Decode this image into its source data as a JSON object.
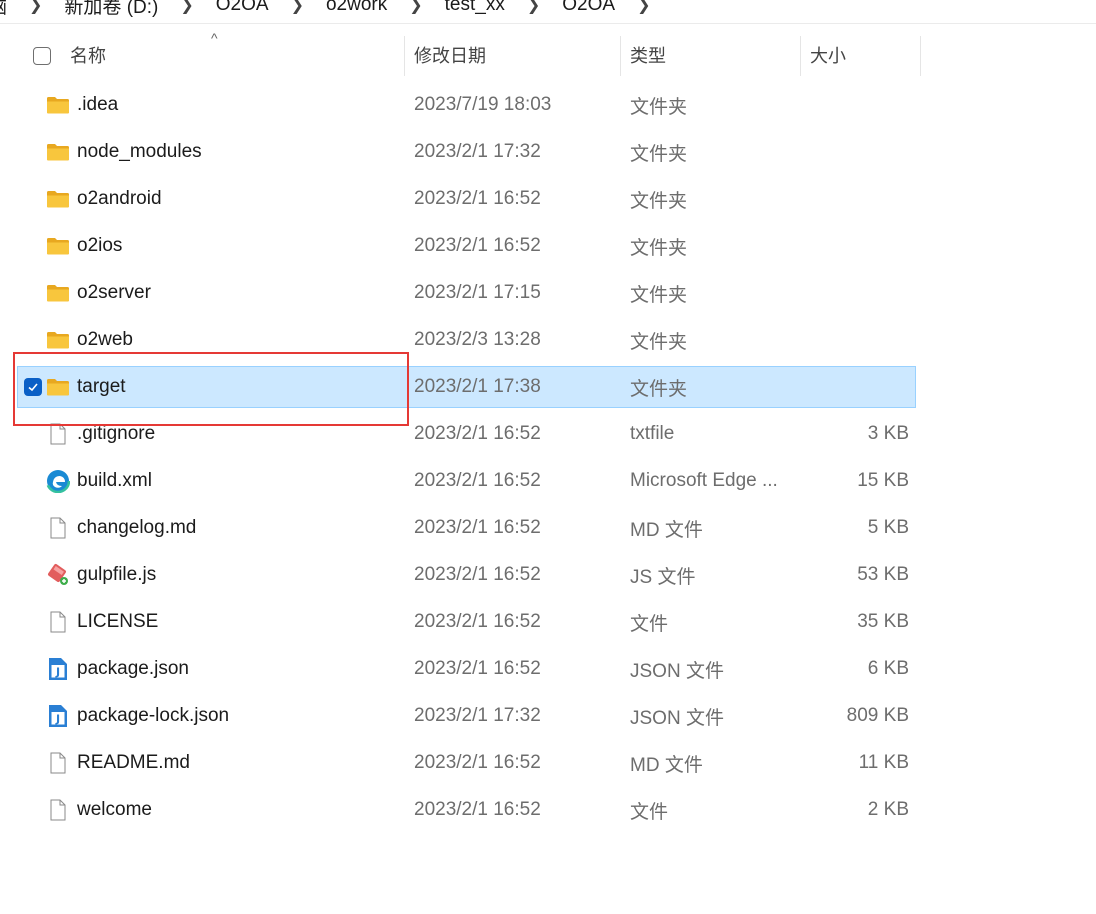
{
  "breadcrumb": [
    "脑",
    "新加卷 (D:)",
    "O2OA",
    "o2work",
    "test_xx",
    "O2OA"
  ],
  "columns": {
    "name": "名称",
    "date": "修改日期",
    "type": "类型",
    "size": "大小"
  },
  "files": [
    {
      "name": ".idea",
      "date": "2023/7/19 18:03",
      "type": "文件夹",
      "size": "",
      "icon": "folder-icon",
      "selected": false
    },
    {
      "name": "node_modules",
      "date": "2023/2/1 17:32",
      "type": "文件夹",
      "size": "",
      "icon": "folder-icon",
      "selected": false
    },
    {
      "name": "o2android",
      "date": "2023/2/1 16:52",
      "type": "文件夹",
      "size": "",
      "icon": "folder-icon",
      "selected": false
    },
    {
      "name": "o2ios",
      "date": "2023/2/1 16:52",
      "type": "文件夹",
      "size": "",
      "icon": "folder-icon",
      "selected": false
    },
    {
      "name": "o2server",
      "date": "2023/2/1 17:15",
      "type": "文件夹",
      "size": "",
      "icon": "folder-icon",
      "selected": false
    },
    {
      "name": "o2web",
      "date": "2023/2/3 13:28",
      "type": "文件夹",
      "size": "",
      "icon": "folder-icon",
      "selected": false
    },
    {
      "name": "target",
      "date": "2023/2/1 17:38",
      "type": "文件夹",
      "size": "",
      "icon": "folder-icon",
      "selected": true
    },
    {
      "name": ".gitignore",
      "date": "2023/2/1 16:52",
      "type": "txtfile",
      "size": "3 KB",
      "icon": "file-icon",
      "selected": false
    },
    {
      "name": "build.xml",
      "date": "2023/2/1 16:52",
      "type": "Microsoft Edge ...",
      "size": "15 KB",
      "icon": "edge-icon",
      "selected": false
    },
    {
      "name": "changelog.md",
      "date": "2023/2/1 16:52",
      "type": "MD 文件",
      "size": "5 KB",
      "icon": "file-icon",
      "selected": false
    },
    {
      "name": "gulpfile.js",
      "date": "2023/2/1 16:52",
      "type": "JS 文件",
      "size": "53 KB",
      "icon": "script-icon",
      "selected": false
    },
    {
      "name": "LICENSE",
      "date": "2023/2/1 16:52",
      "type": "文件",
      "size": "35 KB",
      "icon": "file-icon",
      "selected": false
    },
    {
      "name": "package.json",
      "date": "2023/2/1 16:52",
      "type": "JSON 文件",
      "size": "6 KB",
      "icon": "json-icon",
      "selected": false
    },
    {
      "name": "package-lock.json",
      "date": "2023/2/1 17:32",
      "type": "JSON 文件",
      "size": "809 KB",
      "icon": "json-icon",
      "selected": false
    },
    {
      "name": "README.md",
      "date": "2023/2/1 16:52",
      "type": "MD 文件",
      "size": "11 KB",
      "icon": "file-icon",
      "selected": false
    },
    {
      "name": "welcome",
      "date": "2023/2/1 16:52",
      "type": "文件",
      "size": "2 KB",
      "icon": "file-icon",
      "selected": false
    }
  ],
  "colors": {
    "selection": "#cce8ff",
    "highlight_box": "#e53935",
    "checkbox_checked": "#0a5fc6",
    "folder": "#f8c63d"
  }
}
